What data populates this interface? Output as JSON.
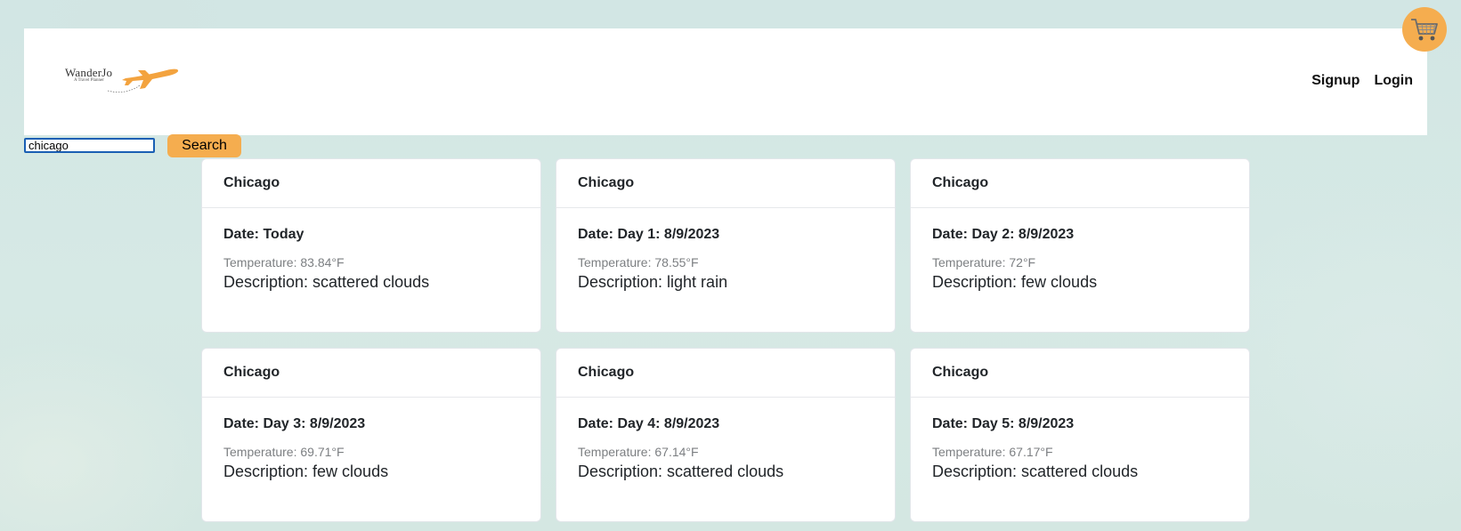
{
  "header": {
    "logo": {
      "name": "WanderJo",
      "tagline": "A Travel Planner"
    },
    "nav": {
      "signup": "Signup",
      "login": "Login"
    }
  },
  "cart": {
    "icon": "shopping-cart-icon",
    "color": "#f5ad4f"
  },
  "search": {
    "value": "chicago",
    "button_label": "Search"
  },
  "colors": {
    "accent": "#f5ad4f",
    "background": "#d4e7e4"
  },
  "forecast": [
    {
      "city": "Chicago",
      "date": "Date: Today",
      "temperature": "Temperature: 83.84°F",
      "description": "Description: scattered clouds"
    },
    {
      "city": "Chicago",
      "date": "Date: Day 1: 8/9/2023",
      "temperature": "Temperature: 78.55°F",
      "description": "Description: light rain"
    },
    {
      "city": "Chicago",
      "date": "Date: Day 2: 8/9/2023",
      "temperature": "Temperature: 72°F",
      "description": "Description: few clouds"
    },
    {
      "city": "Chicago",
      "date": "Date: Day 3: 8/9/2023",
      "temperature": "Temperature: 69.71°F",
      "description": "Description: few clouds"
    },
    {
      "city": "Chicago",
      "date": "Date: Day 4: 8/9/2023",
      "temperature": "Temperature: 67.14°F",
      "description": "Description: scattered clouds"
    },
    {
      "city": "Chicago",
      "date": "Date: Day 5: 8/9/2023",
      "temperature": "Temperature: 67.17°F",
      "description": "Description: scattered clouds"
    }
  ]
}
